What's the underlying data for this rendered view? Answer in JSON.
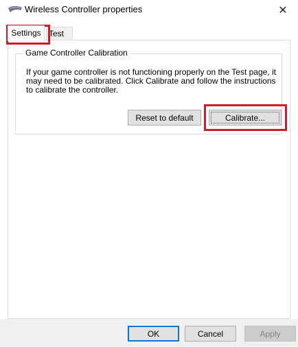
{
  "window": {
    "title": "Wireless Controller properties",
    "icon": "game-controller-icon",
    "close_glyph": "✕"
  },
  "tabs": [
    {
      "label": "Settings",
      "active": true
    },
    {
      "label": "Test",
      "active": false
    }
  ],
  "calibration": {
    "group_title": "Game Controller Calibration",
    "description": "If your game controller is not functioning properly on the Test page, it may need to be calibrated.  Click Calibrate and follow the instructions to calibrate the controller.",
    "reset_label": "Reset to default",
    "calibrate_label": "Calibrate..."
  },
  "footer": {
    "ok_label": "OK",
    "cancel_label": "Cancel",
    "apply_label": "Apply"
  },
  "colors": {
    "highlight": "#d11a2a",
    "default_button_border": "#0078d7"
  }
}
